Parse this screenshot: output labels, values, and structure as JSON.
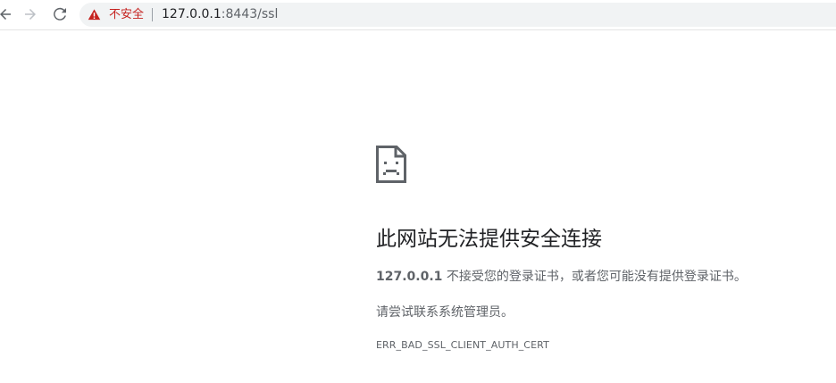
{
  "toolbar": {
    "back_icon": "back-arrow-icon",
    "forward_icon": "forward-arrow-icon",
    "reload_icon": "reload-icon",
    "security_icon": "warning-triangle-icon",
    "security_label": "不安全",
    "url_host": "127.0.0.1",
    "url_rest": ":8443/ssl",
    "warning_color": "#c5221f"
  },
  "error_page": {
    "icon": "sad-document-icon",
    "title": "此网站无法提供安全连接",
    "host": "127.0.0.1",
    "description": " 不接受您的登录证书，或者您可能没有提供登录证书。",
    "suggestion": "请尝试联系系统管理员。",
    "error_code": "ERR_BAD_SSL_CLIENT_AUTH_CERT"
  }
}
